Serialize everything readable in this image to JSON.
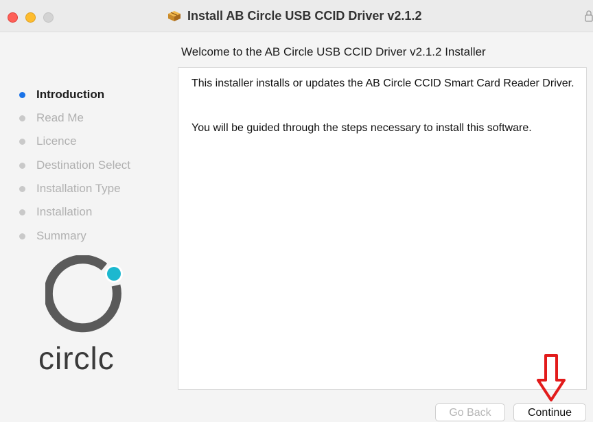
{
  "window": {
    "title": "Install AB Circle USB CCID Driver v2.1.2",
    "traffic_lights": [
      "close",
      "minimize",
      "maximize"
    ]
  },
  "main": {
    "heading": "Welcome to the AB Circle USB CCID Driver v2.1.2 Installer",
    "paragraphs": [
      "This installer installs or updates the AB Circle CCID Smart Card Reader Driver.",
      "You will be guided through the steps necessary to install this software."
    ]
  },
  "sidebar": {
    "steps": [
      {
        "label": "Introduction",
        "active": true
      },
      {
        "label": "Read Me",
        "active": false
      },
      {
        "label": "Licence",
        "active": false
      },
      {
        "label": "Destination Select",
        "active": false
      },
      {
        "label": "Installation Type",
        "active": false
      },
      {
        "label": "Installation",
        "active": false
      },
      {
        "label": "Summary",
        "active": false
      }
    ],
    "logo_text": "circlc"
  },
  "footer": {
    "back_label": "Go Back",
    "continue_label": "Continue"
  },
  "colors": {
    "active_dot": "#1a73e8",
    "annotation_arrow": "#e21b1b",
    "logo_accent": "#1cb8cf"
  },
  "icons": {
    "title": "package-icon",
    "lock": "lock-icon",
    "annotation": "down-arrow-icon"
  }
}
